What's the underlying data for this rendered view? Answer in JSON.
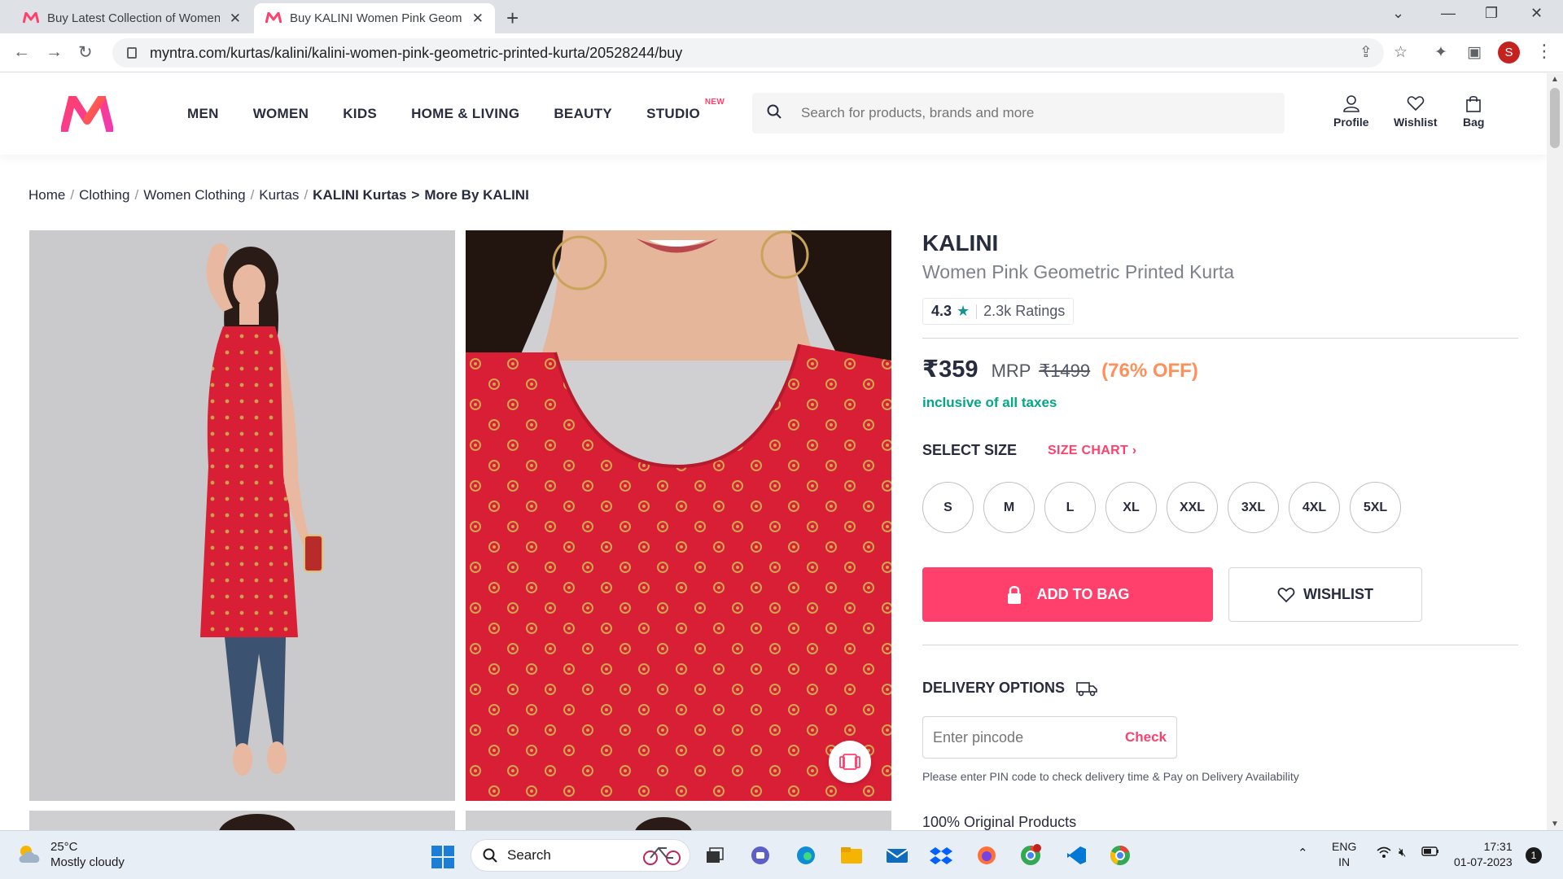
{
  "browser": {
    "tabs": [
      {
        "title": "Buy Latest Collection of Women K",
        "active": false
      },
      {
        "title": "Buy KALINI Women Pink Geometr",
        "active": true
      }
    ],
    "url": "myntra.com/kurtas/kalini/kalini-women-pink-geometric-printed-kurta/20528244/buy",
    "profile_initial": "S"
  },
  "header": {
    "nav": [
      "MEN",
      "WOMEN",
      "KIDS",
      "HOME & LIVING",
      "BEAUTY",
      "STUDIO"
    ],
    "studio_badge": "NEW",
    "search_placeholder": "Search for products, brands and more",
    "profile": "Profile",
    "wishlist": "Wishlist",
    "bag": "Bag"
  },
  "breadcrumb": {
    "items": [
      "Home",
      "Clothing",
      "Women Clothing",
      "Kurtas"
    ],
    "brand_link": "KALINI Kurtas",
    "arrow": ">",
    "more": "More By KALINI"
  },
  "product": {
    "brand": "KALINI",
    "name": "Women Pink Geometric Printed Kurta",
    "rating": "4.3",
    "ratings_count": "2.3k Ratings",
    "price": "₹359",
    "mrp_label": "MRP",
    "mrp": "₹1499",
    "discount": "(76% OFF)",
    "tax_note": "inclusive of all taxes",
    "select_size": "SELECT SIZE",
    "size_chart": "SIZE CHART",
    "sizes": [
      "S",
      "M",
      "L",
      "XL",
      "XXL",
      "3XL",
      "4XL",
      "5XL"
    ],
    "add_to_bag": "ADD TO BAG",
    "wishlist": "WISHLIST",
    "delivery_heading": "DELIVERY OPTIONS",
    "pincode_placeholder": "Enter pincode",
    "check": "Check",
    "pincode_note": "Please enter PIN code to check delivery time & Pay on Delivery Availability",
    "original": "100% Original Products"
  },
  "colors": {
    "brand_pink": "#ff3f6c",
    "discount_orange": "#ff905a",
    "tax_green": "#03a685",
    "star_teal": "#14958f",
    "kurta_red": "#d81f35"
  },
  "taskbar": {
    "temp": "25°C",
    "weather": "Mostly cloudy",
    "search": "Search",
    "lang1": "ENG",
    "lang2": "IN",
    "time": "17:31",
    "date": "01-07-2023",
    "notifications": "1"
  }
}
